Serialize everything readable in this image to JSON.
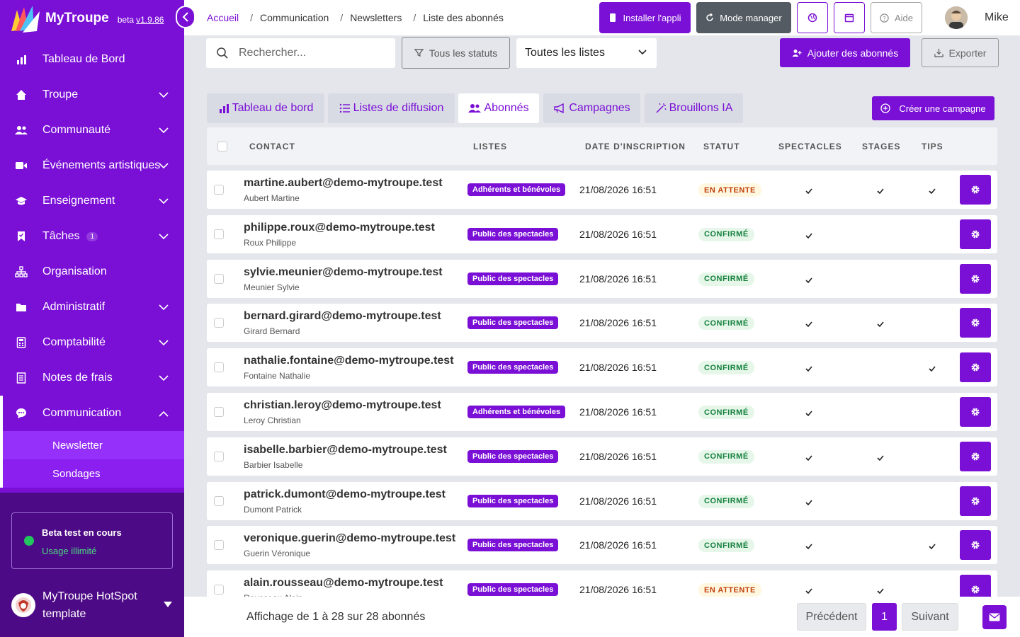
{
  "brand": {
    "name": "MyTroupe",
    "beta": "beta",
    "version": "v1.9.86"
  },
  "breadcrumb": [
    "Accueil",
    "Communication",
    "Newsletters",
    "Liste des abonnés"
  ],
  "topbar": {
    "install": "Installer l'appli",
    "manager": "Mode manager",
    "help": "Aide",
    "user": "Mike"
  },
  "nav": [
    {
      "label": "Tableau de Bord",
      "icon": "bar-chart-icon",
      "chevron": false
    },
    {
      "label": "Troupe",
      "icon": "home-icon",
      "chevron": true
    },
    {
      "label": "Communauté",
      "icon": "users-icon",
      "chevron": true
    },
    {
      "label": "Événements artistiques",
      "icon": "video-icon",
      "chevron": true
    },
    {
      "label": "Enseignement",
      "icon": "graduation-cap-icon",
      "chevron": true
    },
    {
      "label": "Tâches",
      "icon": "bookmark-icon",
      "chevron": true,
      "badge": "1"
    },
    {
      "label": "Organisation",
      "icon": "sitemap-icon",
      "chevron": false
    },
    {
      "label": "Administratif",
      "icon": "folder-icon",
      "chevron": true
    },
    {
      "label": "Comptabilité",
      "icon": "calculator-icon",
      "chevron": true
    },
    {
      "label": "Notes de frais",
      "icon": "receipt-icon",
      "chevron": true
    },
    {
      "label": "Communication",
      "icon": "chat-icon",
      "chevron": true,
      "active": true
    }
  ],
  "subnav": [
    "Newsletter",
    "Sondages"
  ],
  "beta_card": {
    "title": "Beta test en cours",
    "subtitle": "Usage illimité"
  },
  "org": {
    "name": "MyTroupe HotSpot template"
  },
  "filters": {
    "search_placeholder": "Rechercher...",
    "status": "Tous les statuts",
    "lists": "Toutes les listes",
    "add": "Ajouter des abonnés",
    "export": "Exporter"
  },
  "tabs": [
    {
      "label": "Tableau de bord",
      "icon": "bar-chart-icon"
    },
    {
      "label": "Listes de diffusion",
      "icon": "list-icon"
    },
    {
      "label": "Abonnés",
      "icon": "users-icon",
      "active": true
    },
    {
      "label": "Campagnes",
      "icon": "megaphone-icon"
    },
    {
      "label": "Brouillons IA",
      "icon": "magic-wand-icon"
    }
  ],
  "create_campaign": "Créer une campagne",
  "columns": {
    "contact": "CONTACT",
    "lists": "LISTES",
    "date": "DATE D'INSCRIPTION",
    "status": "STATUT",
    "shows": "SPECTACLES",
    "courses": "STAGES",
    "tips": "TIPS"
  },
  "subscribers": [
    {
      "email": "martine.aubert@demo-mytroupe.test",
      "name": "Aubert Martine",
      "list": "Adhérents et bénévoles",
      "date": "21/08/2026 16:51",
      "status": "EN ATTENTE",
      "status_type": "pending",
      "shows": true,
      "courses": true,
      "tips": true
    },
    {
      "email": "philippe.roux@demo-mytroupe.test",
      "name": "Roux Philippe",
      "list": "Public des spectacles",
      "date": "21/08/2026 16:51",
      "status": "CONFIRMÉ",
      "status_type": "confirmed",
      "shows": true,
      "courses": false,
      "tips": false
    },
    {
      "email": "sylvie.meunier@demo-mytroupe.test",
      "name": "Meunier Sylvie",
      "list": "Public des spectacles",
      "date": "21/08/2026 16:51",
      "status": "CONFIRMÉ",
      "status_type": "confirmed",
      "shows": true,
      "courses": false,
      "tips": false
    },
    {
      "email": "bernard.girard@demo-mytroupe.test",
      "name": "Girard Bernard",
      "list": "Public des spectacles",
      "date": "21/08/2026 16:51",
      "status": "CONFIRMÉ",
      "status_type": "confirmed",
      "shows": true,
      "courses": true,
      "tips": false
    },
    {
      "email": "nathalie.fontaine@demo-mytroupe.test",
      "name": "Fontaine Nathalie",
      "list": "Public des spectacles",
      "date": "21/08/2026 16:51",
      "status": "CONFIRMÉ",
      "status_type": "confirmed",
      "shows": true,
      "courses": false,
      "tips": true
    },
    {
      "email": "christian.leroy@demo-mytroupe.test",
      "name": "Leroy Christian",
      "list": "Adhérents et bénévoles",
      "date": "21/08/2026 16:51",
      "status": "CONFIRMÉ",
      "status_type": "confirmed",
      "shows": true,
      "courses": false,
      "tips": false
    },
    {
      "email": "isabelle.barbier@demo-mytroupe.test",
      "name": "Barbier Isabelle",
      "list": "Public des spectacles",
      "date": "21/08/2026 16:51",
      "status": "CONFIRMÉ",
      "status_type": "confirmed",
      "shows": true,
      "courses": true,
      "tips": false
    },
    {
      "email": "patrick.dumont@demo-mytroupe.test",
      "name": "Dumont Patrick",
      "list": "Public des spectacles",
      "date": "21/08/2026 16:51",
      "status": "CONFIRMÉ",
      "status_type": "confirmed",
      "shows": true,
      "courses": false,
      "tips": false
    },
    {
      "email": "veronique.guerin@demo-mytroupe.test",
      "name": "Guerin Véronique",
      "list": "Public des spectacles",
      "date": "21/08/2026 16:51",
      "status": "CONFIRMÉ",
      "status_type": "confirmed",
      "shows": true,
      "courses": false,
      "tips": true
    },
    {
      "email": "alain.rousseau@demo-mytroupe.test",
      "name": "Rousseau Alain",
      "list": "Public des spectacles",
      "date": "21/08/2026 16:51",
      "status": "EN ATTENTE",
      "status_type": "pending",
      "shows": true,
      "courses": true,
      "tips": false
    }
  ],
  "footer": {
    "showing": "Affichage de 1 à 28 sur 28 abonnés",
    "prev": "Précédent",
    "page": "1",
    "next": "Suivant"
  },
  "colors": {
    "primary": "#7a0fd6",
    "sidebar_bottom": "#4d0a86",
    "pending": "#c2410c",
    "confirmed": "#15803d"
  }
}
